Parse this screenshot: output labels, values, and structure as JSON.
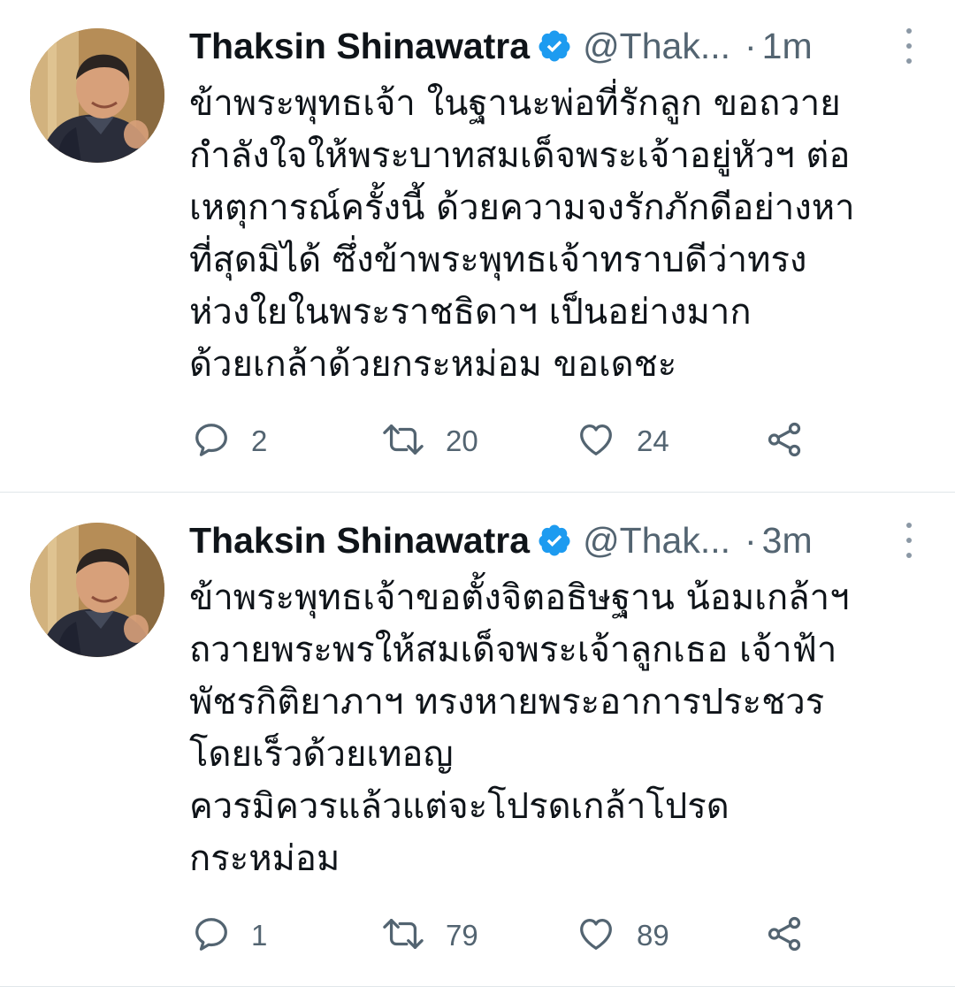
{
  "tweets": [
    {
      "name": "Thaksin Shinawatra",
      "handle": "@Thak...",
      "separator": "·",
      "time": "1m",
      "lines": [
        "ข้าพระพุทธเจ้า ในฐานะพ่อที่รักลูก ขอถวาย",
        "กำลังใจให้พระบาทสมเด็จพระเจ้าอยู่หัวฯ ต่อ",
        "เหตุการณ์ครั้งนี้ ด้วยความจงรักภักดีอย่างหา",
        "ที่สุดมิได้ ซึ่งข้าพระพุทธเจ้าทราบดีว่าทรง",
        "ห่วงใยในพระราชธิดาฯ เป็นอย่างมาก",
        "ด้วยเกล้าด้วยกระหม่อม ขอเดชะ"
      ],
      "replies": "2",
      "retweets": "20",
      "likes": "24"
    },
    {
      "name": "Thaksin Shinawatra",
      "handle": "@Thak...",
      "separator": "·",
      "time": "3m",
      "lines": [
        "ข้าพระพุทธเจ้าขอตั้งจิตอธิษฐาน น้อมเกล้าฯ",
        "ถวายพระพรให้สมเด็จพระเจ้าลูกเธอ เจ้าฟ้า",
        "พัชรกิติยาภาฯ ทรงหายพระอาการประชวร",
        "โดยเร็วด้วยเทอญ",
        "ควรมิควรแล้วแต่จะโปรดเกล้าโปรด",
        "กระหม่อม"
      ],
      "replies": "1",
      "retweets": "79",
      "likes": "89"
    }
  ],
  "icons": {
    "verified": "verified-badge-icon",
    "more": "more-options-icon",
    "reply": "reply-icon",
    "retweet": "retweet-icon",
    "like": "heart-icon",
    "share": "share-icon"
  },
  "colors": {
    "verified": "#1d9bf0",
    "secondary_text": "#536471",
    "primary_text": "#0f1419",
    "divider": "#e1e6ea"
  }
}
